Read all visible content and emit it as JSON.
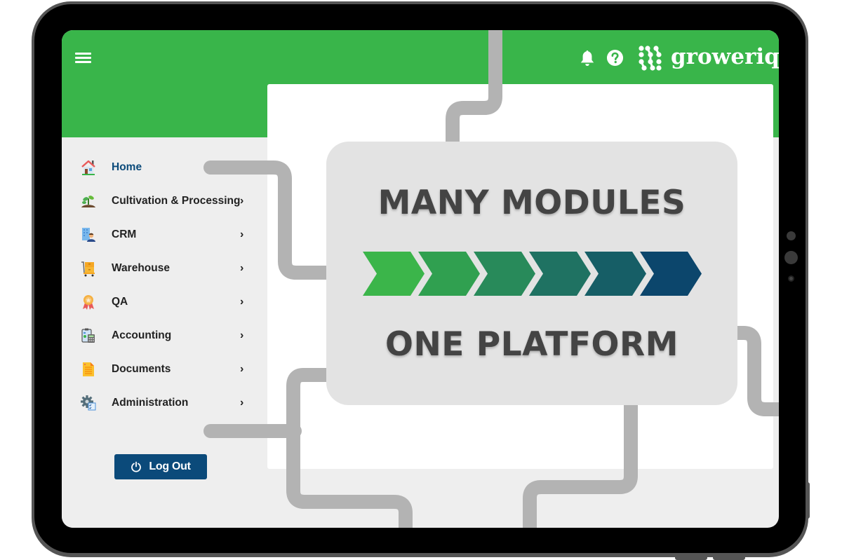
{
  "header": {
    "menu_icon": "hamburger-menu-icon",
    "notification_icon": "bell-icon",
    "help_icon": "question-circle-icon",
    "brand": "groweriq",
    "brand_color": "#39b54a"
  },
  "sidebar": {
    "items": [
      {
        "label": "Home",
        "icon": "house-icon",
        "active": true,
        "has_submenu": false
      },
      {
        "label": "Cultivation & Processing",
        "icon": "sprout-icon",
        "active": false,
        "has_submenu": true
      },
      {
        "label": "CRM",
        "icon": "customer-icon",
        "active": false,
        "has_submenu": true
      },
      {
        "label": "Warehouse",
        "icon": "cart-box-icon",
        "active": false,
        "has_submenu": true
      },
      {
        "label": "QA",
        "icon": "award-ribbon-icon",
        "active": false,
        "has_submenu": true
      },
      {
        "label": "Accounting",
        "icon": "calculator-clipboard-icon",
        "active": false,
        "has_submenu": true
      },
      {
        "label": "Documents",
        "icon": "document-icon",
        "active": false,
        "has_submenu": true
      },
      {
        "label": "Administration",
        "icon": "gear-checklist-icon",
        "active": false,
        "has_submenu": true
      }
    ],
    "chevron": "›",
    "logout_label": "Log Out",
    "logout_icon": "power-icon",
    "logout_color": "#0b4a7a"
  },
  "banner": {
    "title_top": "MANY MODULES",
    "title_bottom": "ONE PLATFORM",
    "chevron_colors": [
      "#3bb54a",
      "#30a050",
      "#288a5a",
      "#1f7262",
      "#165e66",
      "#0c466c"
    ]
  }
}
